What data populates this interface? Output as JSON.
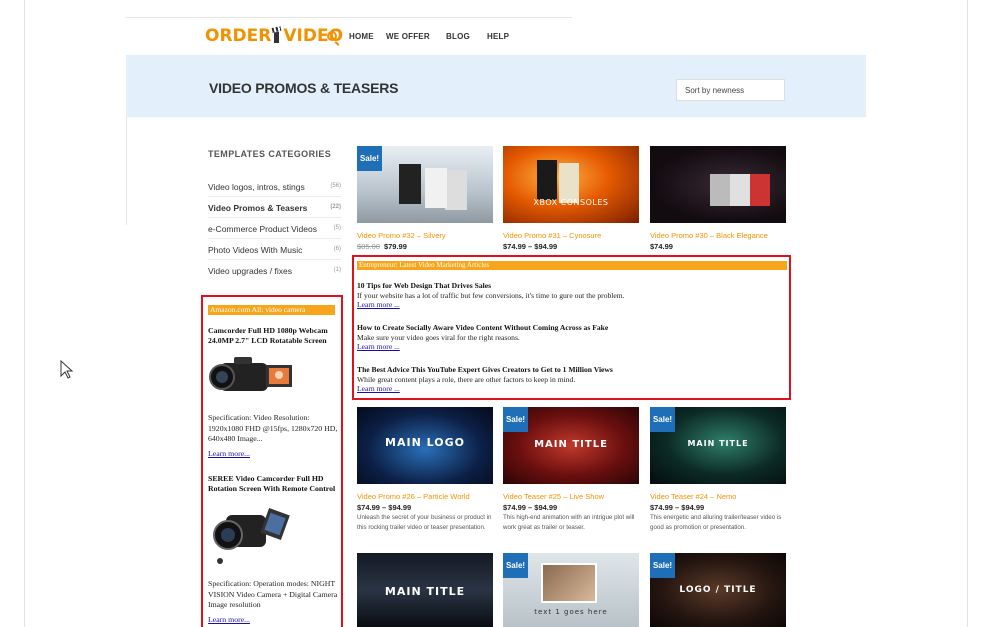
{
  "header": {
    "logo_left": "ORDER",
    "logo_right": "VIDEO",
    "nav": [
      "HOME",
      "WE OFFER",
      "BLOG",
      "HELP"
    ],
    "search_icon": "search-icon"
  },
  "hero": {
    "title": "VIDEO PROMOS & TEASERS",
    "sort_label": "Sort by newness",
    "background": "#e3f0fc"
  },
  "sidebar": {
    "heading": "TEMPLATES CATEGORIES",
    "categories": [
      {
        "label": "Video logos, intros, stings",
        "count": "(56)"
      },
      {
        "label": "Video Promos & Teasers",
        "count": "(22)"
      },
      {
        "label": "e-Commerce Product Videos",
        "count": "(5)"
      },
      {
        "label": "Photo Videos With Music",
        "count": "(6)"
      },
      {
        "label": "Video upgrades / fixes",
        "count": "(1)"
      }
    ]
  },
  "amazon_widget": {
    "heading": "Amazon.com All: video camera",
    "items": [
      {
        "title": "Camcorder Full HD 1080p Webcam 24.0MP 2.7\" LCD Rotatable Screen",
        "spec": "Specification: Video Resolution: 1920x1080 FHD @15fps, 1280x720 HD, 640x480 Image...",
        "link": "Learn more..."
      },
      {
        "title": "SEREE Video Camcorder Full HD Rotation Screen With Remote Control",
        "spec": "Specification: Operation modes: NIGHT VISION Video Camera + Digital Camera Image resolution",
        "link": "Learn more..."
      }
    ]
  },
  "products_row1": [
    {
      "sale": "Sale!",
      "thumb_text": "",
      "name": "Video Promo #32 – Silvery",
      "old_price": "$85.00",
      "price": "$79.99"
    },
    {
      "sale": "",
      "thumb_text": "XBOX CONSOLES",
      "name": "Video Promo #31 – Cynosure",
      "old_price": "",
      "price": "$74.99 – $94.99"
    },
    {
      "sale": "",
      "thumb_text": "",
      "name": "Video Promo #30 – Black Elegance",
      "old_price": "",
      "price": "$74.99"
    }
  ],
  "entrepreneur_widget": {
    "heading": "Entrepreneur: Latest Video Marketing Articles",
    "articles": [
      {
        "title": "10 Tips for Web Design That Drives Sales",
        "desc": "If your website has a lot of traffic but few conversions, it's time to gure out the problem.",
        "link": "Learn more ..."
      },
      {
        "title": "How to Create Socially Aware Video Content Without Coming Across as Fake",
        "desc": "Make sure your video goes viral for the right reasons.",
        "link": "Learn more ..."
      },
      {
        "title": "The Best Advice This YouTube Expert Gives Creators to Get to 1 Million Views",
        "desc": "While great content plays a role, there are other factors to keep in mind.",
        "link": "Learn more ..."
      }
    ]
  },
  "products_row2": [
    {
      "sale": "",
      "thumb_text": "MAIN LOGO",
      "name": "Video Promo #26 – Particle World",
      "price": "$74.99 – $94.99",
      "desc": "Unleash the secret of your business or product in this rocking trailer video or teaser presentation."
    },
    {
      "sale": "Sale!",
      "thumb_text": "MAIN TITLE",
      "name": "Video Teaser #25 – Live Show",
      "price": "$74.99 – $94.99",
      "desc": "This high-end animation with an intrigue plot will work great as trailer or teaser."
    },
    {
      "sale": "Sale!",
      "thumb_text": "MAIN TITLE",
      "name": "Video Teaser #24 – Nemo",
      "price": "$74.99 – $94.99",
      "desc": "This energetic and alluring trailer/teaser video is good as promotion or presentation."
    }
  ],
  "products_row3": [
    {
      "sale": "",
      "thumb_text": "MAIN TITLE"
    },
    {
      "sale": "Sale!",
      "thumb_text": "text 1 goes here"
    },
    {
      "sale": "Sale!",
      "thumb_text": "LOGO / TITLE"
    }
  ],
  "colors": {
    "accent": "#f39200",
    "sale_badge": "#1f6fb8",
    "widget_border": "#e0101e",
    "widget_head": "#f7a61b",
    "link": "#1a0dab"
  }
}
